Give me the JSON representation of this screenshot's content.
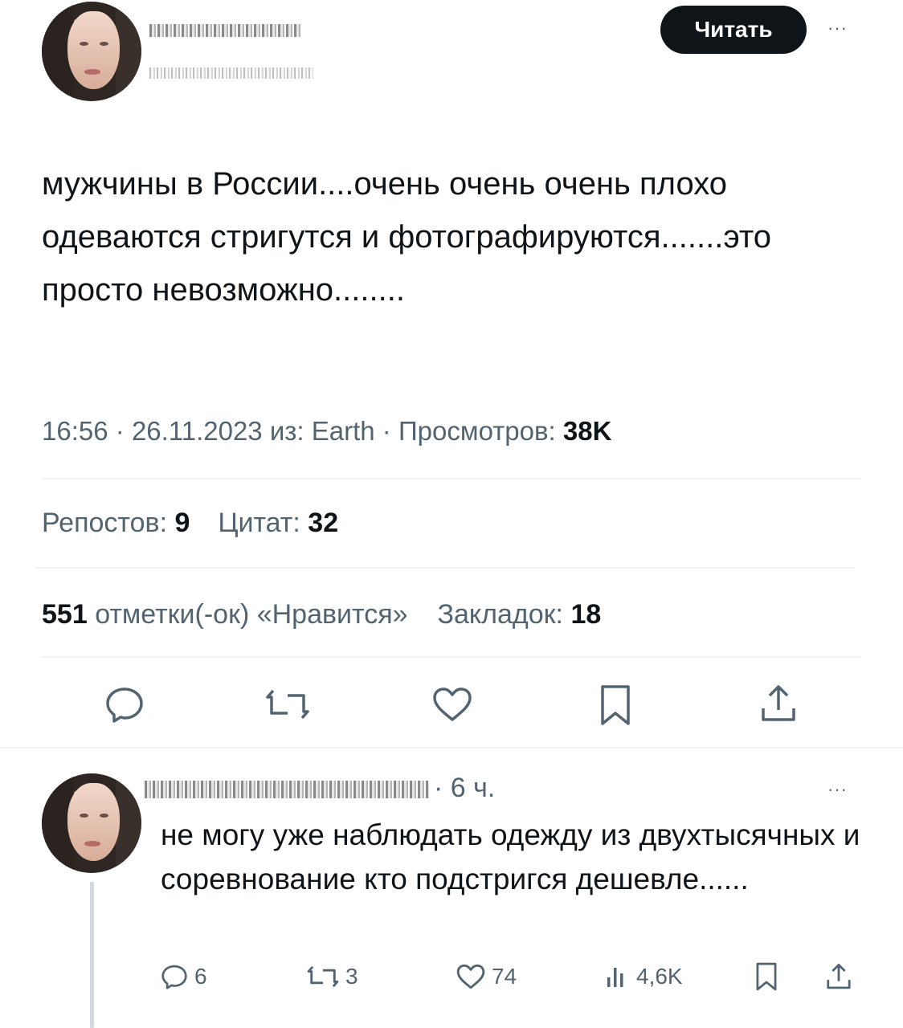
{
  "tweet": {
    "follow_label": "Читать",
    "more": "···",
    "text": "мужчины в России....очень очень очень плохо одеваются стригутся и фотографируются.......это просто невозможно........",
    "time": "16:56",
    "date": "26.11.2023",
    "source_label": "из:",
    "source": "Earth",
    "views_label": "Просмотров:",
    "views": "38K",
    "reposts_label": "Репостов:",
    "reposts": "9",
    "quotes_label": "Цитат:",
    "quotes": "32",
    "likes": "551",
    "likes_label": "отметки(-ок) «Нравится»",
    "bookmarks_label": "Закладок:",
    "bookmarks": "18",
    "actions": [
      "reply-icon",
      "repost-icon",
      "like-icon",
      "bookmark-icon",
      "share-icon"
    ]
  },
  "reply": {
    "time": "6 ч.",
    "more": "···",
    "text": "не могу уже наблюдать одежду из двухтысячных и соревнование кто подстригся дешевле......",
    "replies": "6",
    "reposts": "3",
    "likes": "74",
    "views": "4,6K"
  },
  "colors": {
    "text": "#0f1419",
    "secondary": "#536471",
    "divider": "#eff3f4",
    "button": "#0f1419"
  }
}
